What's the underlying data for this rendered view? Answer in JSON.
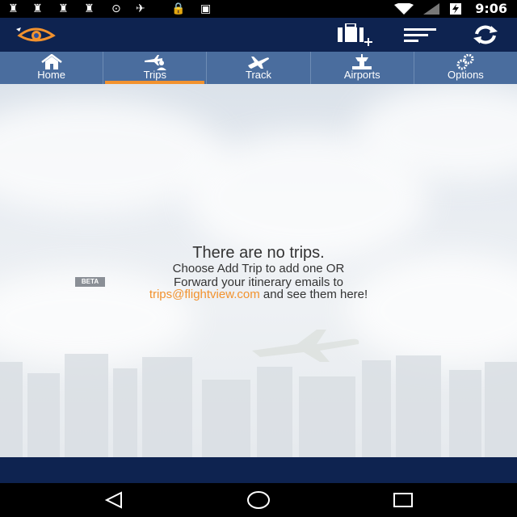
{
  "status_bar": {
    "time": "9:06",
    "icons": [
      "notification-icon",
      "notification-icon",
      "notification-icon",
      "notification-icon",
      "sync-icon",
      "satellite-icon",
      "lock-icon",
      "android-icon",
      "wifi-icon",
      "signal-icon",
      "battery-charging-icon"
    ]
  },
  "app_bar": {
    "logo": "flightview-eye-logo",
    "actions": [
      "add-trip-icon",
      "sort-icon",
      "refresh-icon"
    ]
  },
  "tabs": [
    {
      "label": "Home",
      "icon": "home-icon",
      "active": false
    },
    {
      "label": "Trips",
      "icon": "trips-icon",
      "active": true
    },
    {
      "label": "Track",
      "icon": "plane-icon",
      "active": false
    },
    {
      "label": "Airports",
      "icon": "airport-tower-icon",
      "active": false
    },
    {
      "label": "Options",
      "icon": "gears-icon",
      "active": false
    }
  ],
  "empty_state": {
    "title": "There are no trips.",
    "line1": "Choose Add Trip to add one OR",
    "line2": "Forward your itinerary emails to",
    "email": "trips@flightview.com",
    "line3_suffix": " and see them here!",
    "badge": "BETA"
  },
  "colors": {
    "app_bar": "#0e2350",
    "tab_bar": "#4a6d9e",
    "accent": "#f2922e"
  },
  "nav": [
    "back-icon",
    "home-circle-icon",
    "recents-icon"
  ]
}
